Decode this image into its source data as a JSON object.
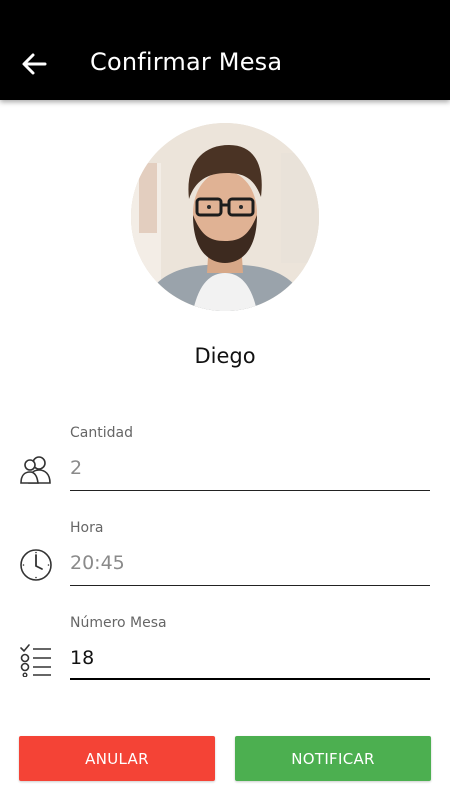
{
  "header": {
    "title": "Confirmar Mesa",
    "back_icon": "arrow-left-icon"
  },
  "profile": {
    "name": "Diego",
    "avatar": "user-photo"
  },
  "form": {
    "cantidad": {
      "label": "Cantidad",
      "value": "2",
      "icon": "people-icon"
    },
    "hora": {
      "label": "Hora",
      "value": "20:45",
      "icon": "clock-icon"
    },
    "numero_mesa": {
      "label": "Número Mesa",
      "value": "18",
      "icon": "checklist-icon"
    }
  },
  "actions": {
    "cancel_label": "ANULAR",
    "notify_label": "NOTIFICAR"
  },
  "colors": {
    "appbar": "#000000",
    "cancel": "#f44336",
    "notify": "#4caf50"
  }
}
